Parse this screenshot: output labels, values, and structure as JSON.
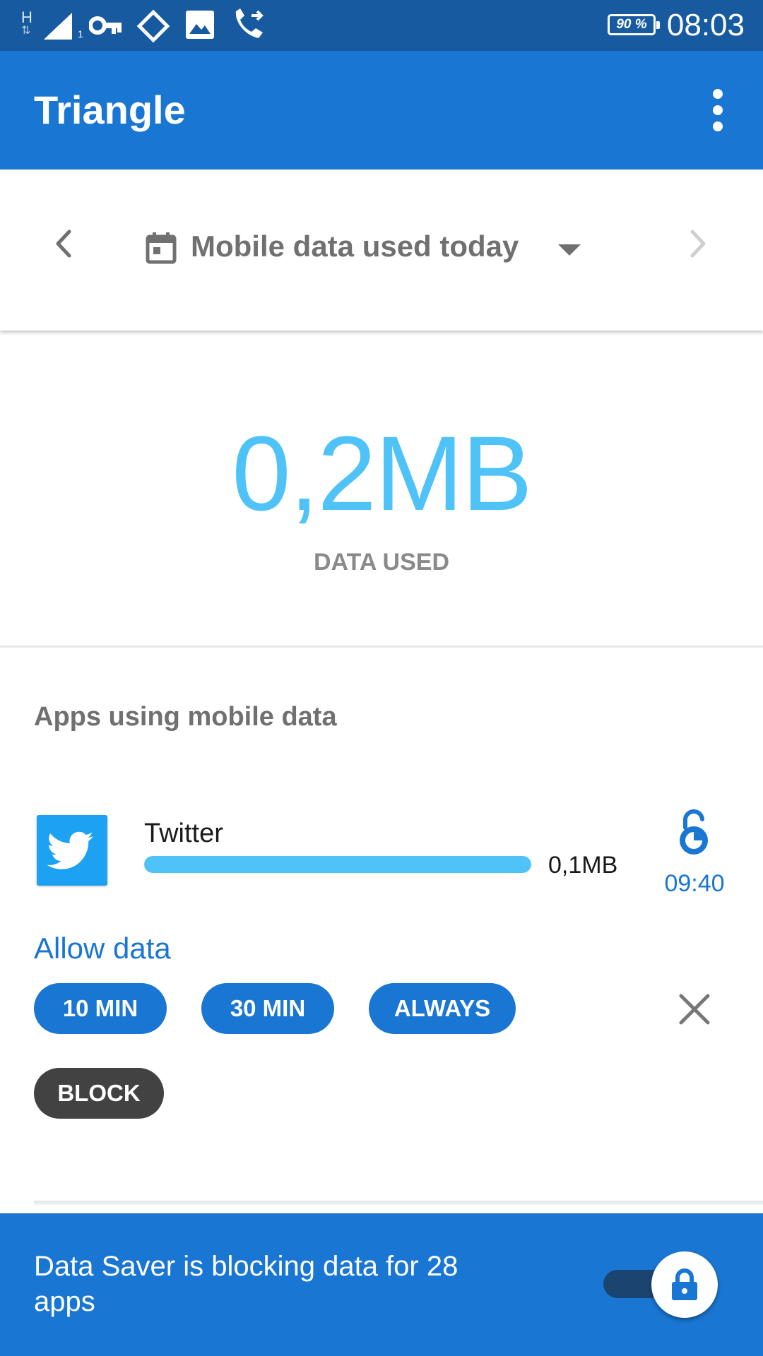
{
  "status_bar": {
    "network_type": "H",
    "sim_slot": "1",
    "battery": "90 %",
    "time": "08:03",
    "icons": [
      "signal-icon",
      "vpn-key-icon",
      "sync-icon",
      "image-icon",
      "call-forward-icon",
      "battery-icon"
    ]
  },
  "app_bar": {
    "title": "Triangle"
  },
  "period_selector": {
    "label": "Mobile data used today"
  },
  "summary": {
    "total": "0,2MB",
    "label": "DATA USED"
  },
  "section": {
    "title": "Apps using mobile data"
  },
  "app_item": {
    "name": "Twitter",
    "usage": "0,1MB",
    "usage_fraction": 1.0,
    "timer": "09:40",
    "brand_color": "#1da1f2"
  },
  "allow_data": {
    "label": "Allow data",
    "options": [
      "10 MIN",
      "30 MIN",
      "ALWAYS"
    ],
    "block_label": "BLOCK"
  },
  "banner": {
    "text": "Data Saver is blocking data for 28 apps"
  },
  "colors": {
    "primary": "#1976d2",
    "status_bar": "#175aa0",
    "accent": "#4fc3f7",
    "block": "#424242"
  }
}
